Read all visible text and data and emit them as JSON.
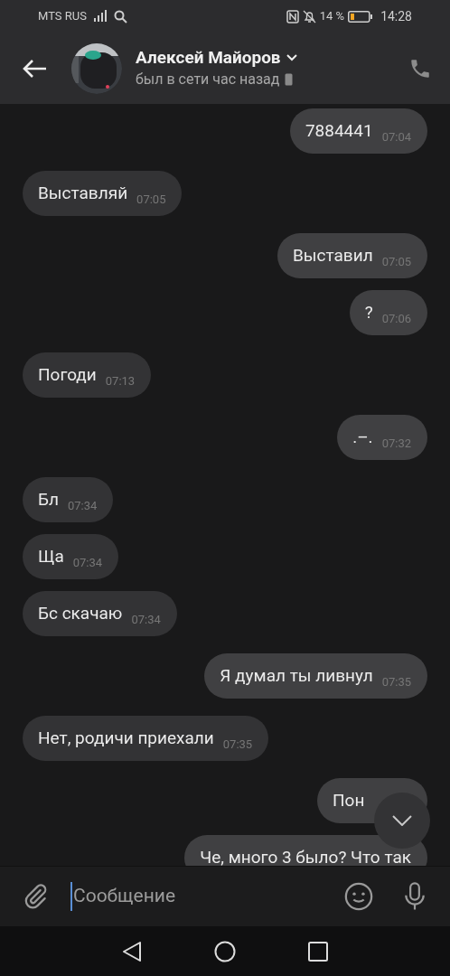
{
  "status_bar": {
    "carrier": "MTS RUS",
    "battery": "14 %",
    "time": "14:28"
  },
  "header": {
    "name": "Алексей Майоров",
    "status": "был в сети час назад"
  },
  "messages": [
    {
      "text": "7884441",
      "time": "07:04",
      "outgoing": true
    },
    {
      "text": "Выставляй",
      "time": "07:05",
      "outgoing": false
    },
    {
      "text": "Выставил",
      "time": "07:05",
      "outgoing": true
    },
    {
      "text": "?",
      "time": "07:06",
      "outgoing": true
    },
    {
      "text": "Погоди",
      "time": "07:13",
      "outgoing": false
    },
    {
      "text": ".–.",
      "time": "07:32",
      "outgoing": true
    },
    {
      "text": "Бл",
      "time": "07:34",
      "outgoing": false
    },
    {
      "text": "Ща",
      "time": "07:34",
      "outgoing": false
    },
    {
      "text": "Бс скачаю",
      "time": "07:34",
      "outgoing": false
    },
    {
      "text": "Я думал ты ливнул",
      "time": "07:35",
      "outgoing": true
    },
    {
      "text": "Нет, родичи приехали",
      "time": "07:35",
      "outgoing": false
    },
    {
      "text": "Пон",
      "outgoing": true
    },
    {
      "text": "Че, много 3 было? Что так",
      "outgoing": true
    }
  ],
  "composer": {
    "placeholder": "Сообщение"
  }
}
